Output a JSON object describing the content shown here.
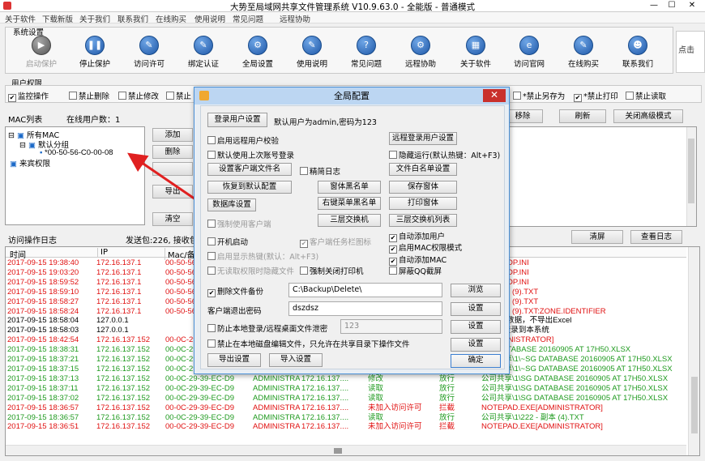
{
  "app": {
    "title": "大势至局域网共享文件管理系统 V10.9.63.0 - 全能版 - 普通模式",
    "min": "—",
    "max": "☐",
    "close": "✕"
  },
  "menu": [
    "关于软件",
    "下载新版",
    "关于我们",
    "联系我们",
    "在线购买",
    "使用说明",
    "常见问题",
    "远程协助"
  ],
  "system": {
    "label": "系统设置",
    "buttons": [
      {
        "label": "启动保护",
        "icon": "play-icon",
        "glyph": "▶",
        "disabled": true
      },
      {
        "label": "停止保护",
        "icon": "pause-icon",
        "glyph": "❚❚"
      },
      {
        "label": "访问许可",
        "icon": "key-icon",
        "glyph": "✎"
      },
      {
        "label": "绑定认证",
        "icon": "bind-icon",
        "glyph": "✎"
      },
      {
        "label": "全局设置",
        "icon": "gear-icon",
        "glyph": "⚙"
      },
      {
        "label": "使用说明",
        "icon": "book-icon",
        "glyph": "✎"
      },
      {
        "label": "常见问题",
        "icon": "question-icon",
        "glyph": "?"
      },
      {
        "label": "远程协助",
        "icon": "remote-icon",
        "glyph": "⚙"
      },
      {
        "label": "关于软件",
        "icon": "info-icon",
        "glyph": "▦"
      },
      {
        "label": "访问官网",
        "icon": "web-icon",
        "glyph": "e"
      },
      {
        "label": "在线购买",
        "icon": "cart-icon",
        "glyph": "✎"
      },
      {
        "label": "联系我们",
        "icon": "contact-icon",
        "glyph": "☻"
      }
    ],
    "logo_text": "点击"
  },
  "perm": {
    "label": "用户权限",
    "items": [
      {
        "label": "监控操作",
        "checked": true
      },
      {
        "label": "禁止删除",
        "checked": false
      },
      {
        "label": "禁止修改",
        "checked": false
      },
      {
        "label": "禁止",
        "checked": false
      }
    ],
    "right_items": [
      {
        "label": "禁止另存为",
        "checked": false
      },
      {
        "label": "禁止打印",
        "checked": true
      },
      {
        "label": "禁止读取",
        "checked": false
      }
    ]
  },
  "mac": {
    "label": "MAC列表",
    "online_label": "在线用户数：",
    "online_count": "1",
    "tree": [
      "所有MAC",
      "默认分组",
      "*00-50-56-C0-00-08",
      "来宾权限"
    ],
    "buttons": [
      "添加",
      "删除",
      "",
      "导出",
      "清空"
    ],
    "right_buttons": [
      "移除",
      "刷新",
      "关闭高级模式"
    ]
  },
  "log": {
    "label": "访问操作日志",
    "stats": "发送包:226, 接收包:",
    "clear": "清屏",
    "view": "查看日志",
    "headers": [
      "时间",
      "IP",
      "Mac/备注"
    ],
    "rows": [
      {
        "c": "red",
        "time": "2017-09-15 19:38:40",
        "ip": "172.16.137.1",
        "mac": "00-50-56",
        "user": "",
        "host": "",
        "op": "",
        "res": "",
        "file": "DESKTOP.INI"
      },
      {
        "c": "red",
        "time": "2017-09-15 19:03:20",
        "ip": "172.16.137.1",
        "mac": "00-50-56",
        "user": "",
        "host": "",
        "op": "",
        "res": "",
        "file": "DESKTOP.INI"
      },
      {
        "c": "red",
        "time": "2017-09-15 18:59:52",
        "ip": "172.16.137.1",
        "mac": "00-50-56",
        "user": "",
        "host": "",
        "op": "",
        "res": "",
        "file": "DESKTOP.INI"
      },
      {
        "c": "red",
        "time": "2017-09-15 18:59:10",
        "ip": "172.16.137.1",
        "mac": "00-50-56",
        "user": "",
        "host": "",
        "op": "",
        "res": "",
        "file": "\\2 - 副本 (9).TXT"
      },
      {
        "c": "red",
        "time": "2017-09-15 18:58:27",
        "ip": "172.16.137.1",
        "mac": "00-50-56",
        "user": "",
        "host": "",
        "op": "",
        "res": "",
        "file": "\\2 - 副本 (9).TXT"
      },
      {
        "c": "red",
        "time": "2017-09-15 18:58:24",
        "ip": "172.16.137.1",
        "mac": "00-50-56",
        "user": "",
        "host": "",
        "op": "",
        "res": "",
        "file": "\\2 - 副本 (9).TXT:ZONE.IDENTIFIER"
      },
      {
        "c": "black",
        "time": "2017-09-15 18:58:04",
        "ip": "127.0.0.1",
        "mac": "",
        "user": "",
        "host": "",
        "op": "",
        "res": "",
        "file": "原库/无数据，不导出Excel"
      },
      {
        "c": "black",
        "time": "2017-09-15 18:58:03",
        "ip": "127.0.0.1",
        "mac": "",
        "user": "",
        "host": "",
        "op": "",
        "res": "",
        "file": "DMIN]登录到本系统"
      },
      {
        "c": "red",
        "time": "2017-09-15 18:42:54",
        "ip": "172.16.137.152",
        "mac": "00-0C-29",
        "user": "",
        "host": "",
        "op": "",
        "res": "",
        "file": "E[ADMINISTRATOR]"
      },
      {
        "c": "green",
        "time": "2017-09-15 18:38:31",
        "ip": "172.16.137.152",
        "mac": "00-0C-29",
        "user": "",
        "host": "",
        "op": "",
        "res": "",
        "file": "\\SG DATABASE 20160905 AT 17H50.XLSX"
      },
      {
        "c": "green",
        "time": "2017-09-15 18:37:21",
        "ip": "172.16.137.152",
        "mac": "00-0C-29",
        "user": "",
        "host": "",
        "op": "",
        "res": "",
        "file": "公司共享\\1\\~SG DATABASE 20160905 AT 17H50.XLSX"
      },
      {
        "c": "green",
        "time": "2017-09-15 18:37:15",
        "ip": "172.16.137.152",
        "mac": "00-0C-29-39-EC-D9",
        "user": "ADMINISTRA...",
        "host": "172.16.137....",
        "op": "读取",
        "res": "放行",
        "file": "公司共享\\1\\~SG DATABASE 20160905 AT 17H50.XLSX"
      },
      {
        "c": "green",
        "time": "2017-09-15 18:37:13",
        "ip": "172.16.137.152",
        "mac": "00-0C-29-39-EC-D9",
        "user": "ADMINISTRA...",
        "host": "172.16.137....",
        "op": "修改",
        "res": "放行",
        "file": "公司共享\\1\\SG DATABASE 20160905 AT 17H50.XLSX"
      },
      {
        "c": "green",
        "time": "2017-09-15 18:37:11",
        "ip": "172.16.137.152",
        "mac": "00-0C-29-39-EC-D9",
        "user": "ADMINISTRA...",
        "host": "172.16.137....",
        "op": "读取",
        "res": "放行",
        "file": "公司共享\\1\\SG DATABASE 20160905 AT 17H50.XLSX"
      },
      {
        "c": "green",
        "time": "2017-09-15 18:37:02",
        "ip": "172.16.137.152",
        "mac": "00-0C-29-39-EC-D9",
        "user": "ADMINISTRA...",
        "host": "172.16.137....",
        "op": "读取",
        "res": "放行",
        "file": "公司共享\\1\\SG DATABASE 20160905 AT 17H50.XLSX"
      },
      {
        "c": "red",
        "time": "2017-09-15 18:36:57",
        "ip": "172.16.137.152",
        "mac": "00-0C-29-39-EC-D9",
        "user": "ADMINISTRA...",
        "host": "172.16.137....",
        "op": "未加入访问许可",
        "res": "拦截",
        "file": "NOTEPAD.EXE[ADMINISTRATOR]"
      },
      {
        "c": "green",
        "time": "2017-09-15 18:36:57",
        "ip": "172.16.137.152",
        "mac": "00-0C-29-39-EC-D9",
        "user": "ADMINISTRA...",
        "host": "172.16.137....",
        "op": "读取",
        "res": "放行",
        "file": "公司共享\\1\\222 - 副本 (4).TXT"
      },
      {
        "c": "red",
        "time": "2017-09-15 18:36:51",
        "ip": "172.16.137.152",
        "mac": "00-0C-29-39-EC-D9",
        "user": "ADMINISTRA...",
        "host": "172.16.137....",
        "op": "未加入访问许可",
        "res": "拦截",
        "file": "NOTEPAD.EXE[ADMINISTRATOR]"
      }
    ]
  },
  "dialog": {
    "title": "全局配置",
    "close": "✕",
    "login_btn": "登录用户设置",
    "login_hint": "默认用户为admin,密码为123",
    "enable_remote": "启用远程用户校验",
    "remote_login_btn": "远程登录用户设置",
    "remember": "默认使用上次账号登录",
    "hide_run": "隐藏运行(默认热键：Alt+F3)",
    "client_filename_btn": "设置客户端文件名",
    "simple_log": "精简日志",
    "file_whitelist_btn": "文件白名单设置",
    "restore_btn": "恢复到默认配置",
    "window_blacklist_btn": "窗体黑名单",
    "save_window_btn": "保存窗体",
    "db_btn": "数据库设置",
    "rclick_blacklist_btn": "右键菜单黑名单",
    "print_window_btn": "打印窗体",
    "l3_btn": "三层交换机",
    "l3_list_btn": "三层交换机列表",
    "force_client": "强制使用客户端",
    "auto_add_user": "自动添加用户",
    "autostart": "开机启动",
    "client_tray": "客户端任务栏图标",
    "enable_mac": "启用MAC权限模式",
    "show_hotkey": "启用显示热键(默认：Alt+F3)",
    "auto_add_mac": "自动添加MAC",
    "no_read_hide": "无读取权限时隐藏文件",
    "force_close_printer": "强制关闭打印机",
    "block_qq": "屏蔽QQ截屏",
    "del_backup": "删除文件备份",
    "del_backup_path": "C:\\Backup\\Delete\\",
    "browse_btn": "浏览",
    "exit_pwd_label": "客户端退出密码",
    "exit_pwd": "dszdsz",
    "set_btn": "设置",
    "anti_leak": "防止本地登录/远程桌面文件泄密",
    "anti_leak_val": "123",
    "ban_edit": "禁止在本地磁盘编辑文件，只允许在共享目录下操作文件",
    "export_btn": "导出设置",
    "import_btn": "导入设置",
    "ok_btn": "确定"
  },
  "colors": {
    "red": "#e01010",
    "green": "#1f9a1f",
    "arrow": "#e02020",
    "accent": "#4a90d6"
  }
}
